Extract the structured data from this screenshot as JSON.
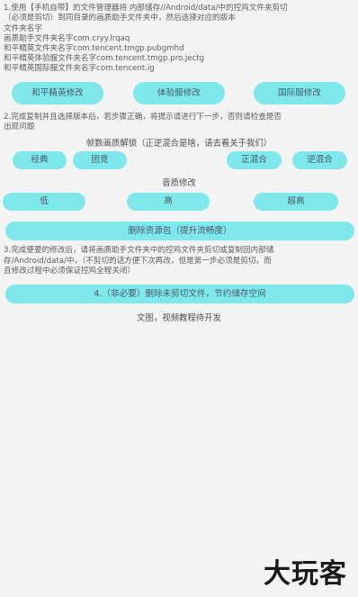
{
  "instructions": {
    "step1_line1": "1.使用【手机自带】的文件管理器将 内部储存//Android/data/中的控鸡文件夹剪切",
    "step1_line2": "（必须是剪切）到同目录的画质助手文件夹中，然后选择对应的版本",
    "package_header": "文件夹名字",
    "package_lines": [
      "画质助手文件夹名字com.cryy.lrqaq",
      "和平精英文件夹名字com.tencent.tmgp.pubgmhd",
      "和平精英体验服文件夹名字com.tencent.tmgp.pro.jectg",
      "和平精英国际服文件夹名字com.tencent.ig"
    ],
    "step2_line1": "2.完成复制并且选择版本后，若步骤正确，将提示请进行下一步，否则请检查是否",
    "step2_line2": "出现问题",
    "step3_line1": "3.完成便要的修改后，请将画质助手文件夹中的控鸡文件夹剪切或复制回内部储",
    "step3_line2": "存/Android/data/中，（不剪切的话方便下次再改，但是第一步必须是剪切，而",
    "step3_line3": "且修改过程中必须保证控鸡全程关闭）"
  },
  "version_buttons": [
    "和平精英修改",
    "体验服修改",
    "国际服修改"
  ],
  "framerate": {
    "title": "帧数画质解锁（正逆混合是啥，请去看关于我们）",
    "buttons": [
      "经典",
      "团竞",
      "正混合",
      "逆混合"
    ]
  },
  "quality": {
    "title": "音质修改",
    "buttons": [
      "低",
      "高",
      "超高"
    ]
  },
  "delete_resource_button": "删除资源包（提升流畅度）",
  "delete_unclipped_button": "4.（非必要）删除未剪切文件，节约储存空间",
  "footer_text": "文图，视频教程待开发",
  "watermark": "大玩客"
}
